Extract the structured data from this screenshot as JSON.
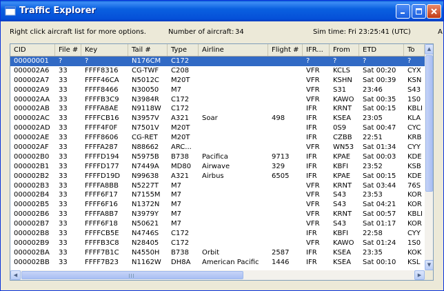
{
  "window": {
    "title": "Traffic Explorer"
  },
  "info": {
    "hint": "Right click aircraft list for more options.",
    "count_label": "Number of aircraft:",
    "count_value": "34",
    "sim_time_label": "Sim time:",
    "sim_time_value": "Fri 23:25:41 (UTC)",
    "cut_text": "A"
  },
  "columns": [
    "CID",
    "File #",
    "Key",
    "Tail #",
    "Type",
    "Airline",
    "Flight #",
    "IFR...",
    "From",
    "ETD",
    "To"
  ],
  "rows": [
    [
      "00000001",
      "?",
      "?",
      "N176CM",
      "C172",
      "",
      "",
      "?",
      "?",
      "?",
      "?"
    ],
    [
      "000002A6",
      "33",
      "FFFF8316",
      "CG-TWF",
      "C208",
      "",
      "",
      "VFR",
      "KCLS",
      "Sat 00:20",
      "CYX"
    ],
    [
      "000002A7",
      "33",
      "FFFF46CA",
      "N5012C",
      "M20T",
      "",
      "",
      "VFR",
      "KSHN",
      "Sat 00:39",
      "KSN"
    ],
    [
      "000002A9",
      "33",
      "FFFF8466",
      "N30050",
      "M7",
      "",
      "",
      "VFR",
      "S31",
      "23:46",
      "S43"
    ],
    [
      "000002AA",
      "33",
      "FFFFB3C9",
      "N3984R",
      "C172",
      "",
      "",
      "VFR",
      "KAWO",
      "Sat 00:35",
      "1S0"
    ],
    [
      "000002AB",
      "33",
      "FFFFA8AE",
      "N9118W",
      "C172",
      "",
      "",
      "IFR",
      "KRNT",
      "Sat 00:15",
      "KBLI"
    ],
    [
      "000002AC",
      "33",
      "FFFFCB16",
      "N3957V",
      "A321",
      "Soar",
      "498",
      "IFR",
      "KSEA",
      "23:05",
      "KLA"
    ],
    [
      "000002AD",
      "33",
      "FFFF4F0F",
      "N7501V",
      "M20T",
      "",
      "",
      "IFR",
      "0S9",
      "Sat 00:47",
      "CYC"
    ],
    [
      "000002AE",
      "33",
      "FFFF8606",
      "CG-RET",
      "M20T",
      "",
      "",
      "IFR",
      "CZBB",
      "22:51",
      "KRB"
    ],
    [
      "000002AF",
      "33",
      "FFFFA287",
      "N88662",
      "ARC...",
      "",
      "",
      "VFR",
      "WN53",
      "Sat 01:34",
      "CYY"
    ],
    [
      "000002B0",
      "33",
      "FFFFD194",
      "N5975B",
      "B738",
      "Pacifica",
      "9713",
      "IFR",
      "KPAE",
      "Sat 00:03",
      "KDE"
    ],
    [
      "000002B1",
      "33",
      "FFFFD177",
      "N7449A",
      "MD80",
      "Airwave",
      "329",
      "IFR",
      "KBFI",
      "23:52",
      "KSB"
    ],
    [
      "000002B2",
      "33",
      "FFFFD19D",
      "N99638",
      "A321",
      "Airbus",
      "6505",
      "IFR",
      "KPAE",
      "Sat 00:15",
      "KDE"
    ],
    [
      "000002B3",
      "33",
      "FFFFA8BB",
      "N5227T",
      "M7",
      "",
      "",
      "VFR",
      "KRNT",
      "Sat 03:44",
      "76S"
    ],
    [
      "000002B4",
      "33",
      "FFFF6F17",
      "N7155M",
      "M7",
      "",
      "",
      "VFR",
      "S43",
      "23:53",
      "KOR"
    ],
    [
      "000002B5",
      "33",
      "FFFF6F16",
      "N1372N",
      "M7",
      "",
      "",
      "VFR",
      "S43",
      "Sat 04:21",
      "KOR"
    ],
    [
      "000002B6",
      "33",
      "FFFFA8B7",
      "N3979Y",
      "M7",
      "",
      "",
      "VFR",
      "KRNT",
      "Sat 00:57",
      "KBLI"
    ],
    [
      "000002B7",
      "33",
      "FFFF6F18",
      "N50621",
      "M7",
      "",
      "",
      "VFR",
      "S43",
      "Sat 01:17",
      "KOR"
    ],
    [
      "000002B8",
      "33",
      "FFFFCB5E",
      "N4746S",
      "C172",
      "",
      "",
      "IFR",
      "KBFI",
      "22:58",
      "CYY"
    ],
    [
      "000002B9",
      "33",
      "FFFFB3C8",
      "N28405",
      "C172",
      "",
      "",
      "VFR",
      "KAWO",
      "Sat 01:24",
      "1S0"
    ],
    [
      "000002BA",
      "33",
      "FFFF7B1C",
      "N4550H",
      "B738",
      "Orbit",
      "2587",
      "IFR",
      "KSEA",
      "23:35",
      "KOK"
    ],
    [
      "000002BB",
      "33",
      "FFFF7B23",
      "N1162W",
      "DH8A",
      "American Pacific",
      "1446",
      "IFR",
      "KSEA",
      "Sat 00:10",
      "KSL"
    ]
  ],
  "colors": {
    "titlebar": "#0a60e0",
    "selection": "#316ac5",
    "face": "#ece9d8"
  }
}
